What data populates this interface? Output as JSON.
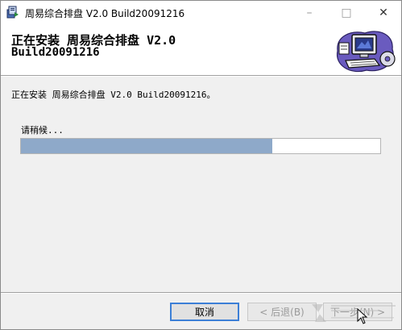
{
  "window": {
    "title": "周易综合排盘 V2.0 Build20091216",
    "app_icon": "installer-package-icon",
    "controls": {
      "minimize": "–",
      "maximize": "□",
      "close": "✕"
    }
  },
  "banner": {
    "title": "正在安装 周易综合排盘 V2.0",
    "subtitle": "Build20091216",
    "art_icon": "computer-install-icon"
  },
  "status": {
    "text": "正在安装 周易综合排盘 V2.0 Build20091216。"
  },
  "progress": {
    "label": "请稍候...",
    "percent": 70
  },
  "buttons": {
    "cancel_label": "取消",
    "back_label": "< 后退(B)",
    "next_label": "下一步(N) >"
  },
  "colors": {
    "progress_fill": "#8ea9c9",
    "focus_border": "#3c7fd6"
  }
}
